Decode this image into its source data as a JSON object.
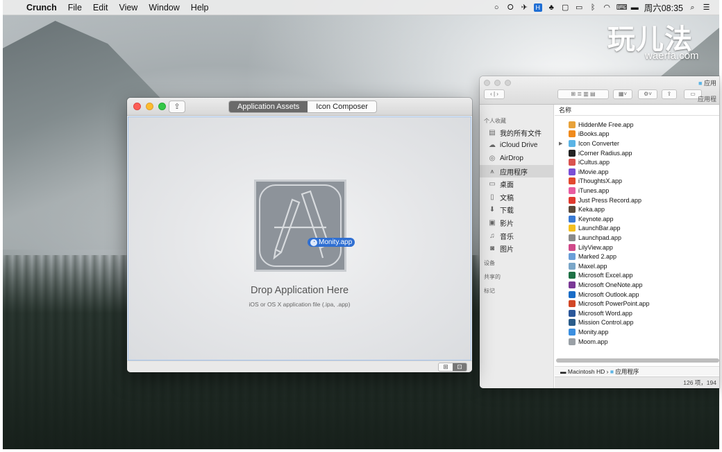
{
  "menubar": {
    "app_name": "Crunch",
    "items": [
      "File",
      "Edit",
      "View",
      "Window",
      "Help"
    ],
    "clock": "周六08:35"
  },
  "watermark": {
    "main": "玩儿法",
    "sub": "waerfa.com"
  },
  "crunch": {
    "tabs": [
      "Application Assets",
      "Icon Composer"
    ],
    "active_tab": "Application Assets",
    "dragged_file": "Monity.app",
    "drop_title": "Drop Application Here",
    "drop_subtitle": "iOS or OS X application file (.ipa, .app)"
  },
  "finder": {
    "window_title": "应用",
    "list_header_name": "名称",
    "list_header_right": "应用程",
    "sidebar": {
      "favorites_heading": "个人收藏",
      "items": [
        {
          "label": "我的所有文件",
          "icon": "all-files-icon"
        },
        {
          "label": "iCloud Drive",
          "icon": "cloud-icon"
        },
        {
          "label": "AirDrop",
          "icon": "airdrop-icon"
        },
        {
          "label": "应用程序",
          "icon": "applications-icon",
          "selected": true
        },
        {
          "label": "桌面",
          "icon": "desktop-icon"
        },
        {
          "label": "文稿",
          "icon": "documents-icon"
        },
        {
          "label": "下载",
          "icon": "downloads-icon"
        },
        {
          "label": "影片",
          "icon": "movies-icon"
        },
        {
          "label": "音乐",
          "icon": "music-icon"
        },
        {
          "label": "图片",
          "icon": "pictures-icon"
        }
      ],
      "devices_heading": "设备",
      "shared_heading": "共享的",
      "tags_heading": "标记"
    },
    "files": [
      {
        "name": "HiddenMe Free.app",
        "color": "#e8a23a"
      },
      {
        "name": "iBooks.app",
        "color": "#f08a1c"
      },
      {
        "name": "Icon Converter",
        "color": "#5bb4e5",
        "folder": true
      },
      {
        "name": "iCorner Radius.app",
        "color": "#222222"
      },
      {
        "name": "iCultus.app",
        "color": "#d9534f"
      },
      {
        "name": "iMovie.app",
        "color": "#7a4fd6"
      },
      {
        "name": "iThoughtsX.app",
        "color": "#e2492f"
      },
      {
        "name": "iTunes.app",
        "color": "#e85da1"
      },
      {
        "name": "Just Press Record.app",
        "color": "#e03a2f"
      },
      {
        "name": "Keka.app",
        "color": "#5a4a3a"
      },
      {
        "name": "Keynote.app",
        "color": "#3a7bd5"
      },
      {
        "name": "LaunchBar.app",
        "color": "#f4c020"
      },
      {
        "name": "Launchpad.app",
        "color": "#8a8a8a"
      },
      {
        "name": "LilyView.app",
        "color": "#d04a8a"
      },
      {
        "name": "Marked 2.app",
        "color": "#6b9fd8"
      },
      {
        "name": "Maxel.app",
        "color": "#7aa6c8"
      },
      {
        "name": "Microsoft Excel.app",
        "color": "#1e7145"
      },
      {
        "name": "Microsoft OneNote.app",
        "color": "#7b3996"
      },
      {
        "name": "Microsoft Outlook.app",
        "color": "#1a6dc7"
      },
      {
        "name": "Microsoft PowerPoint.app",
        "color": "#d24726"
      },
      {
        "name": "Microsoft Word.app",
        "color": "#2b579a"
      },
      {
        "name": "Mission Control.app",
        "color": "#2a5c8a"
      },
      {
        "name": "Monity.app",
        "color": "#3b8fe0"
      },
      {
        "name": "Moom.app",
        "color": "#9aa0a6"
      }
    ],
    "path_disk": "Macintosh HD",
    "path_folder": "应用程序",
    "status": "126 项，194"
  }
}
